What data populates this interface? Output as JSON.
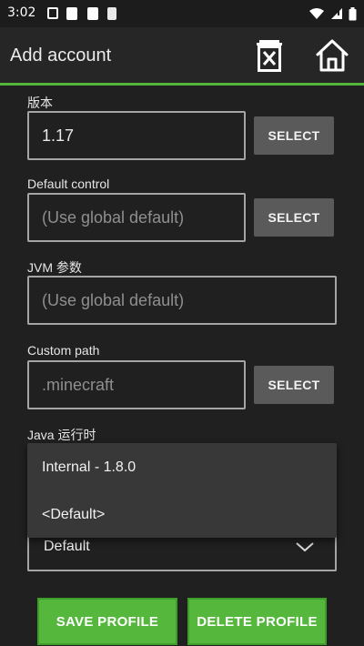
{
  "status_bar": {
    "time": "3:02"
  },
  "app_bar": {
    "title": "Add account"
  },
  "form": {
    "version": {
      "label": "版本",
      "value": "1.17",
      "button": "SELECT"
    },
    "default_control": {
      "label": "Default control",
      "placeholder": "(Use global default)",
      "button": "SELECT"
    },
    "jvm_args": {
      "label": "JVM 参数",
      "placeholder": "(Use global default)"
    },
    "custom_path": {
      "label": "Custom path",
      "placeholder": ".minecraft",
      "button": "SELECT"
    },
    "java_runtime": {
      "label": "Java 运行时",
      "selected": "Default",
      "options": [
        "Internal - 1.8.0",
        "<Default>"
      ]
    }
  },
  "actions": {
    "save": "SAVE PROFILE",
    "delete": "DELETE PROFILE"
  },
  "colors": {
    "accent": "#55b83c",
    "background": "#202020",
    "button_gray": "#5a5a5a"
  }
}
